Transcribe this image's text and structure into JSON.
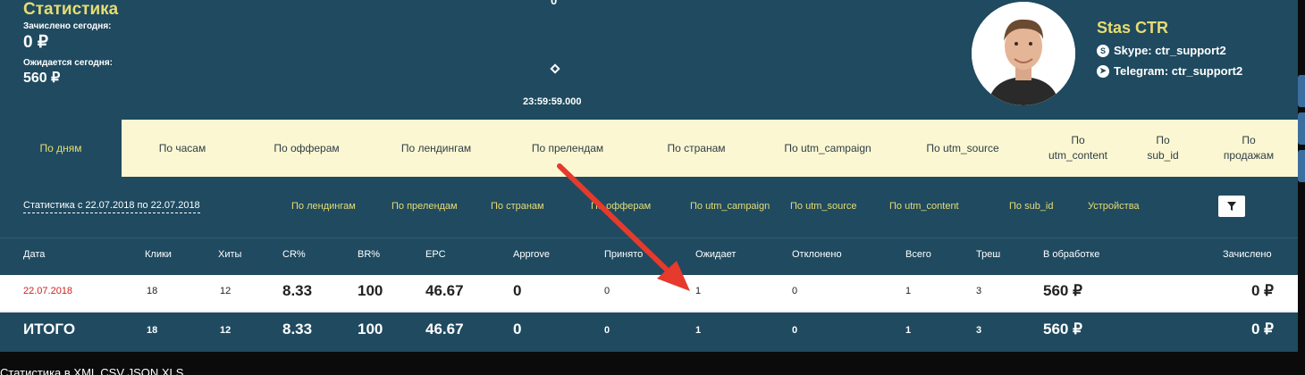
{
  "header": {
    "title": "Статистика",
    "credited_today_label": "Зачислено сегодня:",
    "credited_today_value": "0 ₽",
    "expected_today_label": "Ожидается сегодня:",
    "expected_today_value": "560 ₽",
    "center_top": "0",
    "timer": "23:59:59.000"
  },
  "user": {
    "name": "Stas CTR",
    "skype": "Skype: ctr_support2",
    "telegram": "Telegram: ctr_support2"
  },
  "tabs": [
    {
      "label": "По дням",
      "active": true
    },
    {
      "label": "По часам"
    },
    {
      "label": "По офферам"
    },
    {
      "label": "По лендингам"
    },
    {
      "label": "По прелендам"
    },
    {
      "label": "По странам"
    },
    {
      "label": "По utm_campaign"
    },
    {
      "label": "По utm_source"
    },
    {
      "label": "По\nutm_content"
    },
    {
      "label": "По\nsub_id"
    },
    {
      "label": "По\nпродажам"
    }
  ],
  "filterbar": {
    "date_range": "Статистика с 22.07.2018 по 22.07.2018",
    "links": [
      "По лендингам",
      "По прелендам",
      "По странам",
      "По офферам",
      "По utm_campaign",
      "По utm_source",
      "По utm_content",
      "По sub_id",
      "Устройства"
    ]
  },
  "table": {
    "columns": [
      "Дата",
      "Клики",
      "Хиты",
      "CR%",
      "BR%",
      "EPC",
      "Approve",
      "Принято",
      "Ожидает",
      "Отклонено",
      "Всего",
      "Треш",
      "В обработке",
      "Зачислено"
    ],
    "rows": [
      [
        "22.07.2018",
        "18",
        "12",
        "8.33",
        "100",
        "46.67",
        "0",
        "0",
        "1",
        "0",
        "1",
        "3",
        "560 ₽",
        "0 ₽"
      ]
    ],
    "totals": [
      "ИТОГО",
      "18",
      "12",
      "8.33",
      "100",
      "46.67",
      "0",
      "0",
      "1",
      "0",
      "1",
      "3",
      "560 ₽",
      "0 ₽"
    ]
  },
  "footer": {
    "export_text": "Статистика в XML CSV JSON XLS"
  },
  "colors": {
    "primary": "#1f4a60",
    "accent_yellow": "#e7dc72",
    "tab_bg": "#fbf7d2",
    "annotation_arrow": "#e53a2c"
  },
  "icons": [
    "skype-icon",
    "telegram-icon",
    "filter-icon",
    "diamond-icon"
  ]
}
